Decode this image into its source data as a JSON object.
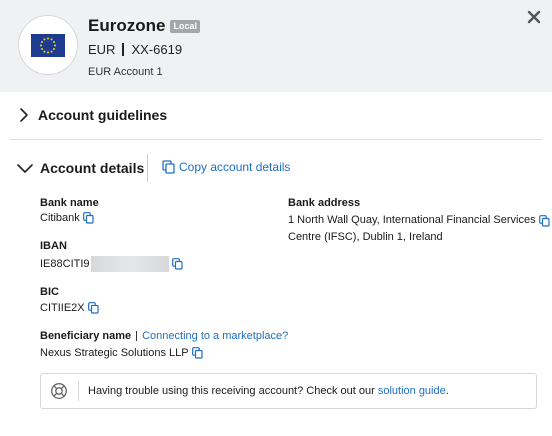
{
  "header": {
    "title": "Eurozone",
    "badge": "Local",
    "currency": "EUR",
    "account_number": "XX-6619",
    "account_name": "EUR Account 1",
    "flag_icon": "eu-flag-icon"
  },
  "sections": {
    "guidelines_title": "Account guidelines",
    "details_title": "Account details",
    "copy_details_label": "Copy account details"
  },
  "fields": {
    "bank_name_label": "Bank name",
    "bank_name_value": "Citibank",
    "iban_label": "IBAN",
    "iban_value": "IE88CITI9",
    "bic_label": "BIC",
    "bic_value": "CITIIE2X",
    "bank_address_label": "Bank address",
    "bank_address_line1": "1 North Wall Quay, International Financial Services",
    "bank_address_line2": "Centre (IFSC), Dublin 1, Ireland",
    "beneficiary_label": "Beneficiary name",
    "marketplace_link": "Connecting to a marketplace?",
    "beneficiary_value": "Nexus Strategic Solutions LLP"
  },
  "help": {
    "text": "Having trouble using this receiving account? Check out our",
    "link": "solution guide",
    "suffix": "."
  },
  "colors": {
    "link": "#1e6fc5",
    "header_bg": "#f0f1f3",
    "flag_blue": "#1d3c8f",
    "flag_stars": "#f7d417"
  }
}
